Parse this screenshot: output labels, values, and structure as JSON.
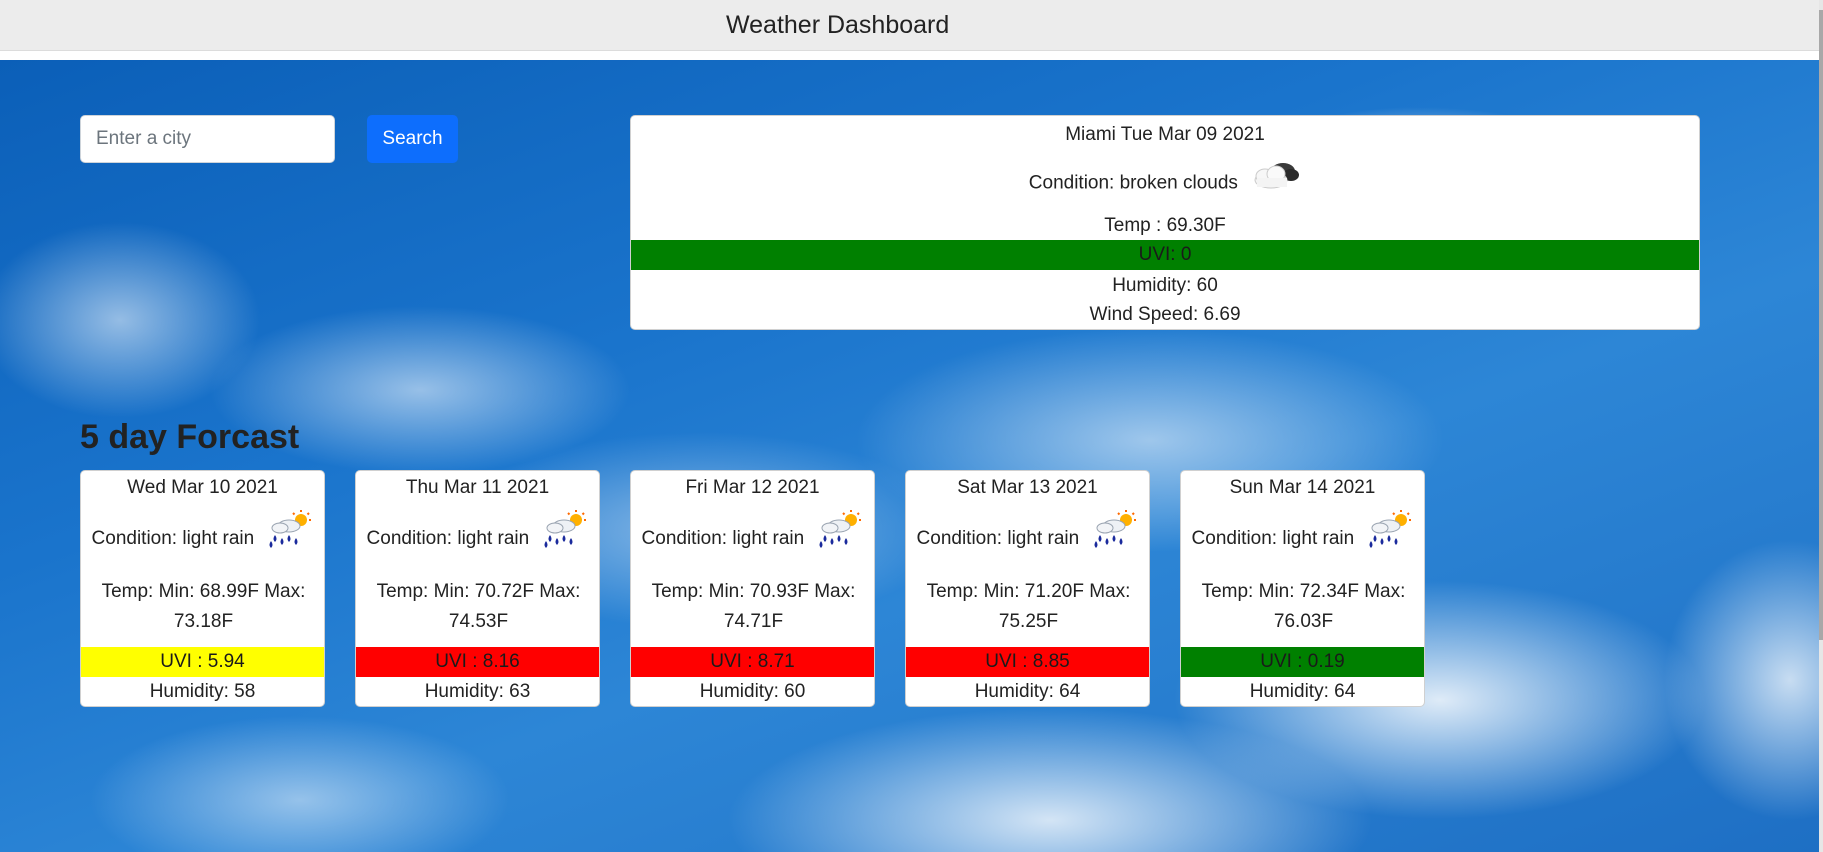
{
  "header": {
    "title": "Weather Dashboard"
  },
  "search": {
    "placeholder": "Enter a city",
    "value": "",
    "button_label": "Search"
  },
  "current": {
    "city_date": "Miami Tue Mar 09 2021",
    "condition": "Condition: broken clouds",
    "icon": "broken-clouds-icon",
    "temp": "Temp : 69.30F",
    "uvi": "UVI: 0",
    "uvi_level": "green",
    "humidity": "Humidity: 60",
    "wind": "Wind Speed: 6.69"
  },
  "forecast": {
    "title": "5 day Forcast",
    "days": [
      {
        "date": "Wed Mar 10 2021",
        "condition": "Condition: light rain",
        "icon": "light-rain-icon",
        "temp": "Temp: Min: 68.99F Max: 73.18F",
        "uvi": "UVI : 5.94",
        "uvi_level": "yellow",
        "humidity": "Humidity: 58"
      },
      {
        "date": "Thu Mar 11 2021",
        "condition": "Condition: light rain",
        "icon": "light-rain-icon",
        "temp": "Temp: Min: 70.72F Max: 74.53F",
        "uvi": "UVI : 8.16",
        "uvi_level": "red",
        "humidity": "Humidity: 63"
      },
      {
        "date": "Fri Mar 12 2021",
        "condition": "Condition: light rain",
        "icon": "light-rain-icon",
        "temp": "Temp: Min: 70.93F Max: 74.71F",
        "uvi": "UVI : 8.71",
        "uvi_level": "red",
        "humidity": "Humidity: 60"
      },
      {
        "date": "Sat Mar 13 2021",
        "condition": "Condition: light rain",
        "icon": "light-rain-icon",
        "temp": "Temp: Min: 71.20F Max: 75.25F",
        "uvi": "UVI : 8.85",
        "uvi_level": "red",
        "humidity": "Humidity: 64"
      },
      {
        "date": "Sun Mar 14 2021",
        "condition": "Condition: light rain",
        "icon": "light-rain-icon",
        "temp": "Temp: Min: 72.34F Max: 76.03F",
        "uvi": "UVI : 0.19",
        "uvi_level": "green",
        "humidity": "Humidity: 64"
      }
    ]
  },
  "colors": {
    "uvi_green": "#008000",
    "uvi_yellow": "#ffff00",
    "uvi_red": "#ff0000",
    "search_button": "#0d6efd"
  }
}
